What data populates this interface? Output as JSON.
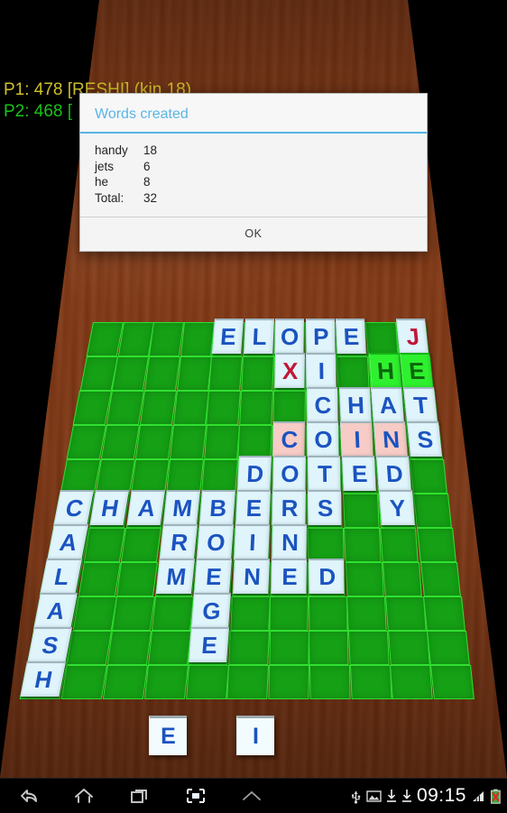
{
  "app": {
    "name": "Word game board",
    "background": "wooden-table",
    "table_color": "#7e3714",
    "board_color": "#15a015",
    "grid_color": "#2fe02f"
  },
  "scores": {
    "p1": "P1: 478 [RESHI] (kin 18)",
    "p1_color": "#cfc02a",
    "p2": "P2: 468 [",
    "p2_color": "#17c217"
  },
  "dialog": {
    "title": "Words created",
    "title_color": "#5ab5e6",
    "words": [
      {
        "word": "handy",
        "score": "18"
      },
      {
        "word": "jets",
        "score": "6"
      },
      {
        "word": "he",
        "score": "8"
      },
      {
        "word": "Total:",
        "score": "32"
      }
    ],
    "ok_label": "OK"
  },
  "board": {
    "columns": 11,
    "rows": 11,
    "tiles": [
      {
        "letter": "E",
        "row": 0,
        "col": 4,
        "style": "normal"
      },
      {
        "letter": "L",
        "row": 0,
        "col": 5,
        "style": "normal"
      },
      {
        "letter": "O",
        "row": 0,
        "col": 6,
        "style": "normal"
      },
      {
        "letter": "P",
        "row": 0,
        "col": 7,
        "style": "normal"
      },
      {
        "letter": "E",
        "row": 0,
        "col": 8,
        "style": "normal"
      },
      {
        "letter": "J",
        "row": 0,
        "col": 10,
        "style": "red"
      },
      {
        "letter": "X",
        "row": 1,
        "col": 6,
        "style": "red"
      },
      {
        "letter": "I",
        "row": 1,
        "col": 7,
        "style": "normal"
      },
      {
        "letter": "H",
        "row": 1,
        "col": 9,
        "style": "new"
      },
      {
        "letter": "E",
        "row": 1,
        "col": 10,
        "style": "new"
      },
      {
        "letter": "C",
        "row": 2,
        "col": 7,
        "style": "normal"
      },
      {
        "letter": "H",
        "row": 2,
        "col": 8,
        "style": "normal"
      },
      {
        "letter": "A",
        "row": 2,
        "col": 9,
        "style": "normal"
      },
      {
        "letter": "T",
        "row": 2,
        "col": 10,
        "style": "normal"
      },
      {
        "letter": "C",
        "row": 3,
        "col": 6,
        "style": "pink"
      },
      {
        "letter": "O",
        "row": 3,
        "col": 7,
        "style": "normal"
      },
      {
        "letter": "I",
        "row": 3,
        "col": 8,
        "style": "pink"
      },
      {
        "letter": "N",
        "row": 3,
        "col": 9,
        "style": "pink"
      },
      {
        "letter": "S",
        "row": 3,
        "col": 10,
        "style": "normal"
      },
      {
        "letter": "D",
        "row": 4,
        "col": 5,
        "style": "normal"
      },
      {
        "letter": "O",
        "row": 4,
        "col": 6,
        "style": "normal"
      },
      {
        "letter": "T",
        "row": 4,
        "col": 7,
        "style": "normal"
      },
      {
        "letter": "E",
        "row": 4,
        "col": 8,
        "style": "normal"
      },
      {
        "letter": "D",
        "row": 4,
        "col": 9,
        "style": "normal"
      },
      {
        "letter": "C",
        "row": 5,
        "col": 0,
        "style": "normal"
      },
      {
        "letter": "H",
        "row": 5,
        "col": 1,
        "style": "normal"
      },
      {
        "letter": "A",
        "row": 5,
        "col": 2,
        "style": "normal"
      },
      {
        "letter": "M",
        "row": 5,
        "col": 3,
        "style": "normal"
      },
      {
        "letter": "B",
        "row": 5,
        "col": 4,
        "style": "normal"
      },
      {
        "letter": "E",
        "row": 5,
        "col": 5,
        "style": "normal"
      },
      {
        "letter": "R",
        "row": 5,
        "col": 6,
        "style": "normal"
      },
      {
        "letter": "S",
        "row": 5,
        "col": 7,
        "style": "normal"
      },
      {
        "letter": "Y",
        "row": 5,
        "col": 9,
        "style": "normal"
      },
      {
        "letter": "A",
        "row": 6,
        "col": 0,
        "style": "normal"
      },
      {
        "letter": "R",
        "row": 6,
        "col": 3,
        "style": "normal"
      },
      {
        "letter": "O",
        "row": 6,
        "col": 4,
        "style": "normal"
      },
      {
        "letter": "I",
        "row": 6,
        "col": 5,
        "style": "normal"
      },
      {
        "letter": "N",
        "row": 6,
        "col": 6,
        "style": "normal"
      },
      {
        "letter": "L",
        "row": 7,
        "col": 0,
        "style": "normal"
      },
      {
        "letter": "M",
        "row": 7,
        "col": 3,
        "style": "normal"
      },
      {
        "letter": "E",
        "row": 7,
        "col": 4,
        "style": "normal"
      },
      {
        "letter": "N",
        "row": 7,
        "col": 5,
        "style": "normal"
      },
      {
        "letter": "E",
        "row": 7,
        "col": 6,
        "style": "normal"
      },
      {
        "letter": "D",
        "row": 7,
        "col": 7,
        "style": "normal"
      },
      {
        "letter": "A",
        "row": 8,
        "col": 0,
        "style": "normal"
      },
      {
        "letter": "G",
        "row": 8,
        "col": 4,
        "style": "normal"
      },
      {
        "letter": "S",
        "row": 9,
        "col": 0,
        "style": "normal"
      },
      {
        "letter": "E",
        "row": 9,
        "col": 4,
        "style": "normal"
      },
      {
        "letter": "H",
        "row": 10,
        "col": 0,
        "style": "normal"
      }
    ]
  },
  "rack": {
    "tiles": [
      {
        "letter": "E"
      },
      {
        "letter": "I"
      }
    ]
  },
  "navbar": {
    "back": "back-icon",
    "home": "home-icon",
    "recents": "recents-icon",
    "screenshot": "screenshot-icon",
    "expand": "expand-icon"
  },
  "statusbar": {
    "usb": "usb-icon",
    "image": "image-icon",
    "download1": "download-icon",
    "download2": "download-icon",
    "clock": "09:15",
    "signal": "signal-icon",
    "battery": "battery-error-icon"
  }
}
